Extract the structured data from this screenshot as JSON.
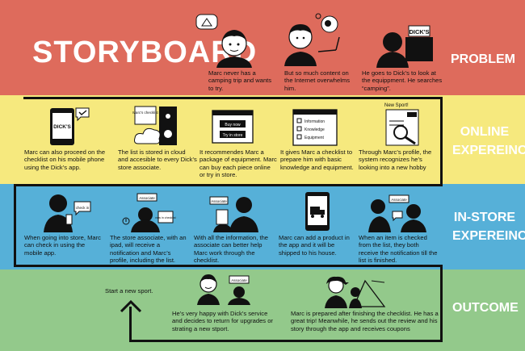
{
  "title": "STORYBOARD",
  "rows": {
    "problem": {
      "label": "PROBLEM",
      "color": "#de6b5c",
      "steps": [
        "Marc never has a camping trip and wants to try.",
        "But so much content on the Internet overwhelms him.",
        "He goes to Dick’s to look at the equippment. He searches “camping”."
      ]
    },
    "online": {
      "label": "ONLINE EXPEREINCE",
      "color": "#f6e97e",
      "steps": [
        "Marc can also proceed on the checklist on his mobile phone using the Dick’s app.",
        "The list is stored in cloud and accesible to every Dick’s store associate.",
        "It recommendes Marc a package of equipment. Marc can buy each piece online or try in store.",
        "It gives Marc a checklist to prepare him with basic knowledge and equipment.",
        "Through Marc’s profile, the system recognizes he’s looking into a new hobby"
      ]
    },
    "instore": {
      "label": "IN-STORE EXPEREINCE",
      "color": "#56b0d8",
      "steps": [
        "When going into store, Marc can check in using the mobile app.",
        "The store associate, with an ipad, will receive a notification and Marc’s profile, including the list.",
        "With all the information, the associate can better help Marc work through the checklist.",
        "Marc can add a product in the app and it will be shipped to his house.",
        "When an item is checked from the list, they both receive the notification till the list is finished."
      ]
    },
    "outcome": {
      "label": "OUTCOME",
      "color": "#93c98b",
      "start": "Start a new sport.",
      "steps": [
        "He’s very happy with Dick’s service and decides to return for upgrades or strating a new stport.",
        "Marc is prepared after finishing the checklist. He has a great trip! Meanwhile, he sends out the review and his story through the app and receives coupons"
      ]
    }
  },
  "sketch_text": {
    "dicks": "DICK'S",
    "marcs_checklist": "Marc's checklist",
    "buy_now": "Buy now",
    "try_in_store": "Try in store",
    "information": "Information",
    "knowledge": "Knowledge",
    "equipment": "Equipment",
    "new_sport": "New Sport!",
    "associate": "Associate",
    "new_in_checklist": "new in checklist",
    "check_in": "check in"
  }
}
